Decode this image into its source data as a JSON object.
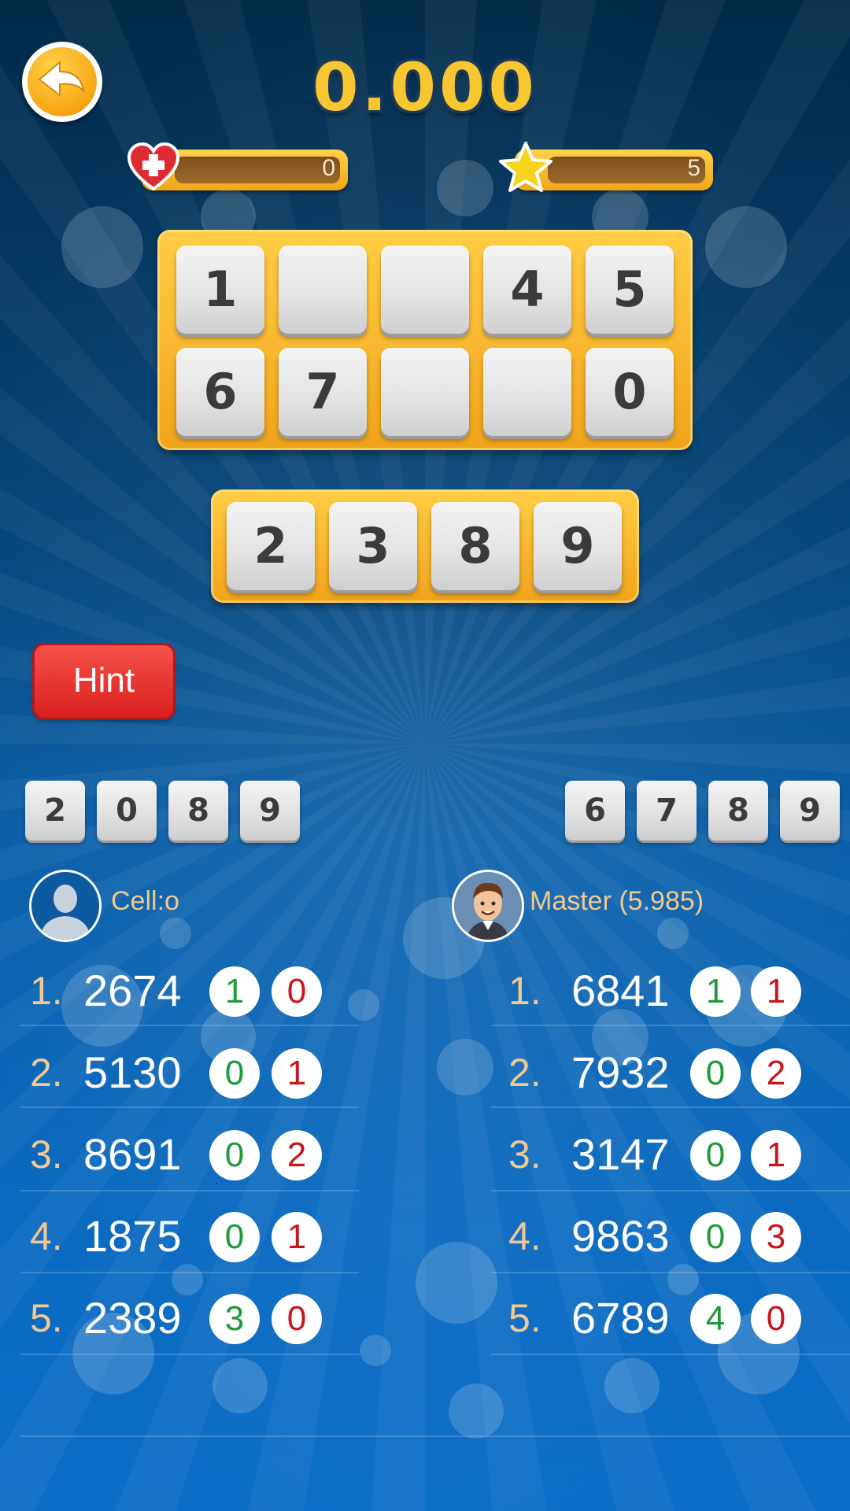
{
  "score": "0.000",
  "lives_bar": {
    "value": "0",
    "icon": "heart-plus-icon"
  },
  "stars_bar": {
    "value": "5",
    "icon": "star-icon"
  },
  "board": {
    "row1": [
      "1",
      "",
      "",
      "4",
      "5"
    ],
    "row2": [
      "6",
      "7",
      "",
      "",
      "0"
    ]
  },
  "current_guess": [
    "2",
    "3",
    "8",
    "9"
  ],
  "hint_label": "Hint",
  "player": {
    "name": "Cell:o",
    "secret": [
      "2",
      "0",
      "8",
      "9"
    ],
    "guesses": [
      {
        "num": "1.",
        "value": "2674",
        "green": "1",
        "red": "0"
      },
      {
        "num": "2.",
        "value": "5130",
        "green": "0",
        "red": "1"
      },
      {
        "num": "3.",
        "value": "8691",
        "green": "0",
        "red": "2"
      },
      {
        "num": "4.",
        "value": "1875",
        "green": "0",
        "red": "1"
      },
      {
        "num": "5.",
        "value": "2389",
        "green": "3",
        "red": "0"
      }
    ]
  },
  "opponent": {
    "name": "Master (5.985)",
    "secret": [
      "6",
      "7",
      "8",
      "9"
    ],
    "guesses": [
      {
        "num": "1.",
        "value": "6841",
        "green": "1",
        "red": "1"
      },
      {
        "num": "2.",
        "value": "7932",
        "green": "0",
        "red": "2"
      },
      {
        "num": "3.",
        "value": "3147",
        "green": "0",
        "red": "1"
      },
      {
        "num": "4.",
        "value": "9863",
        "green": "0",
        "red": "3"
      },
      {
        "num": "5.",
        "value": "6789",
        "green": "4",
        "red": "0"
      }
    ]
  },
  "colors": {
    "accent": "#f7a614",
    "hint": "#e0302a",
    "correct": "#1f9a3b",
    "misplaced": "#c8141a"
  }
}
